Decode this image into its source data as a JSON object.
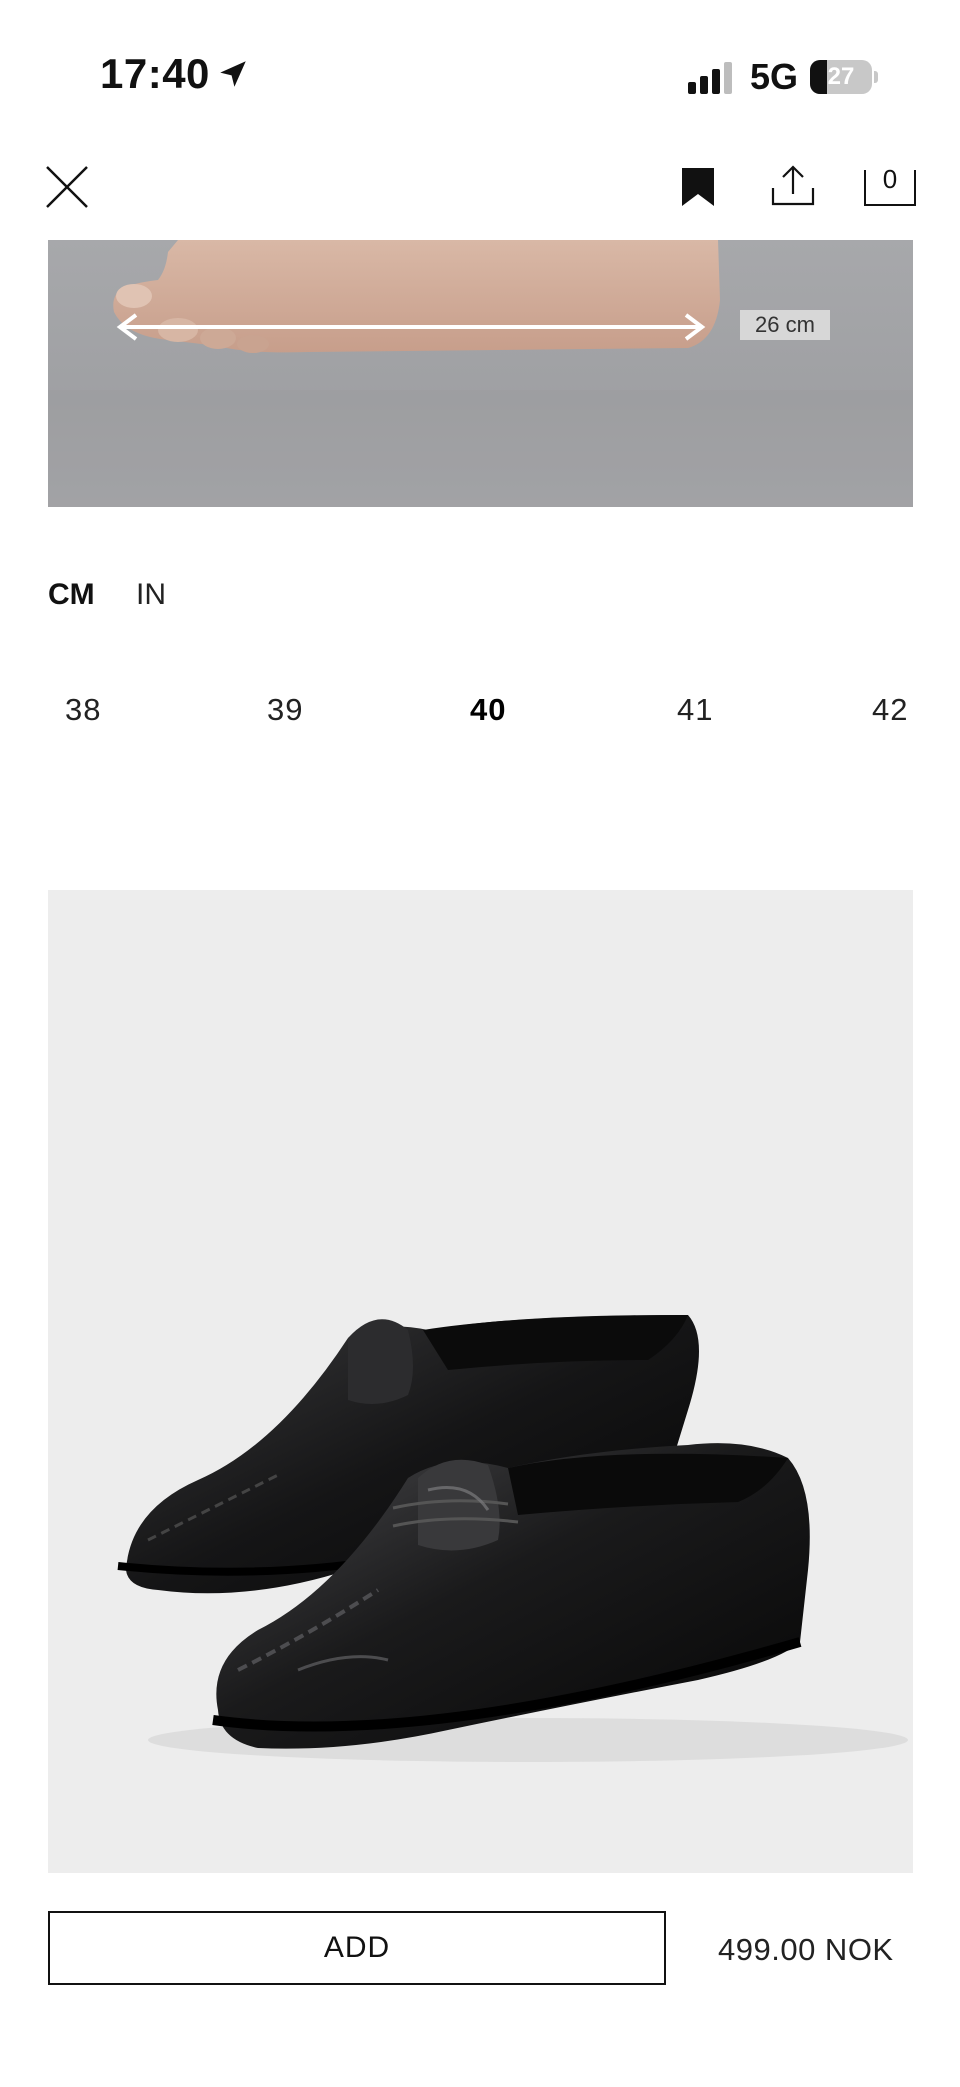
{
  "status_bar": {
    "time": "17:40",
    "network": "5G",
    "battery_level": 27,
    "battery": "27"
  },
  "top_bar": {
    "bag_count": "0"
  },
  "foot_image": {
    "measure_label": "26 cm"
  },
  "units": {
    "cm": "CM",
    "in": "IN",
    "selected": "CM"
  },
  "sizes": {
    "items": [
      "38",
      "39",
      "40",
      "41",
      "42"
    ],
    "selected": "40"
  },
  "product": {
    "image_subject": "black leather penny loafers"
  },
  "footer": {
    "add_label": "ADD",
    "price": "499.00 NOK"
  },
  "icons": [
    "location-arrow-icon",
    "signal-bars-icon",
    "battery-icon",
    "close-icon",
    "bookmark-icon",
    "share-icon",
    "shopping-bag-icon"
  ]
}
